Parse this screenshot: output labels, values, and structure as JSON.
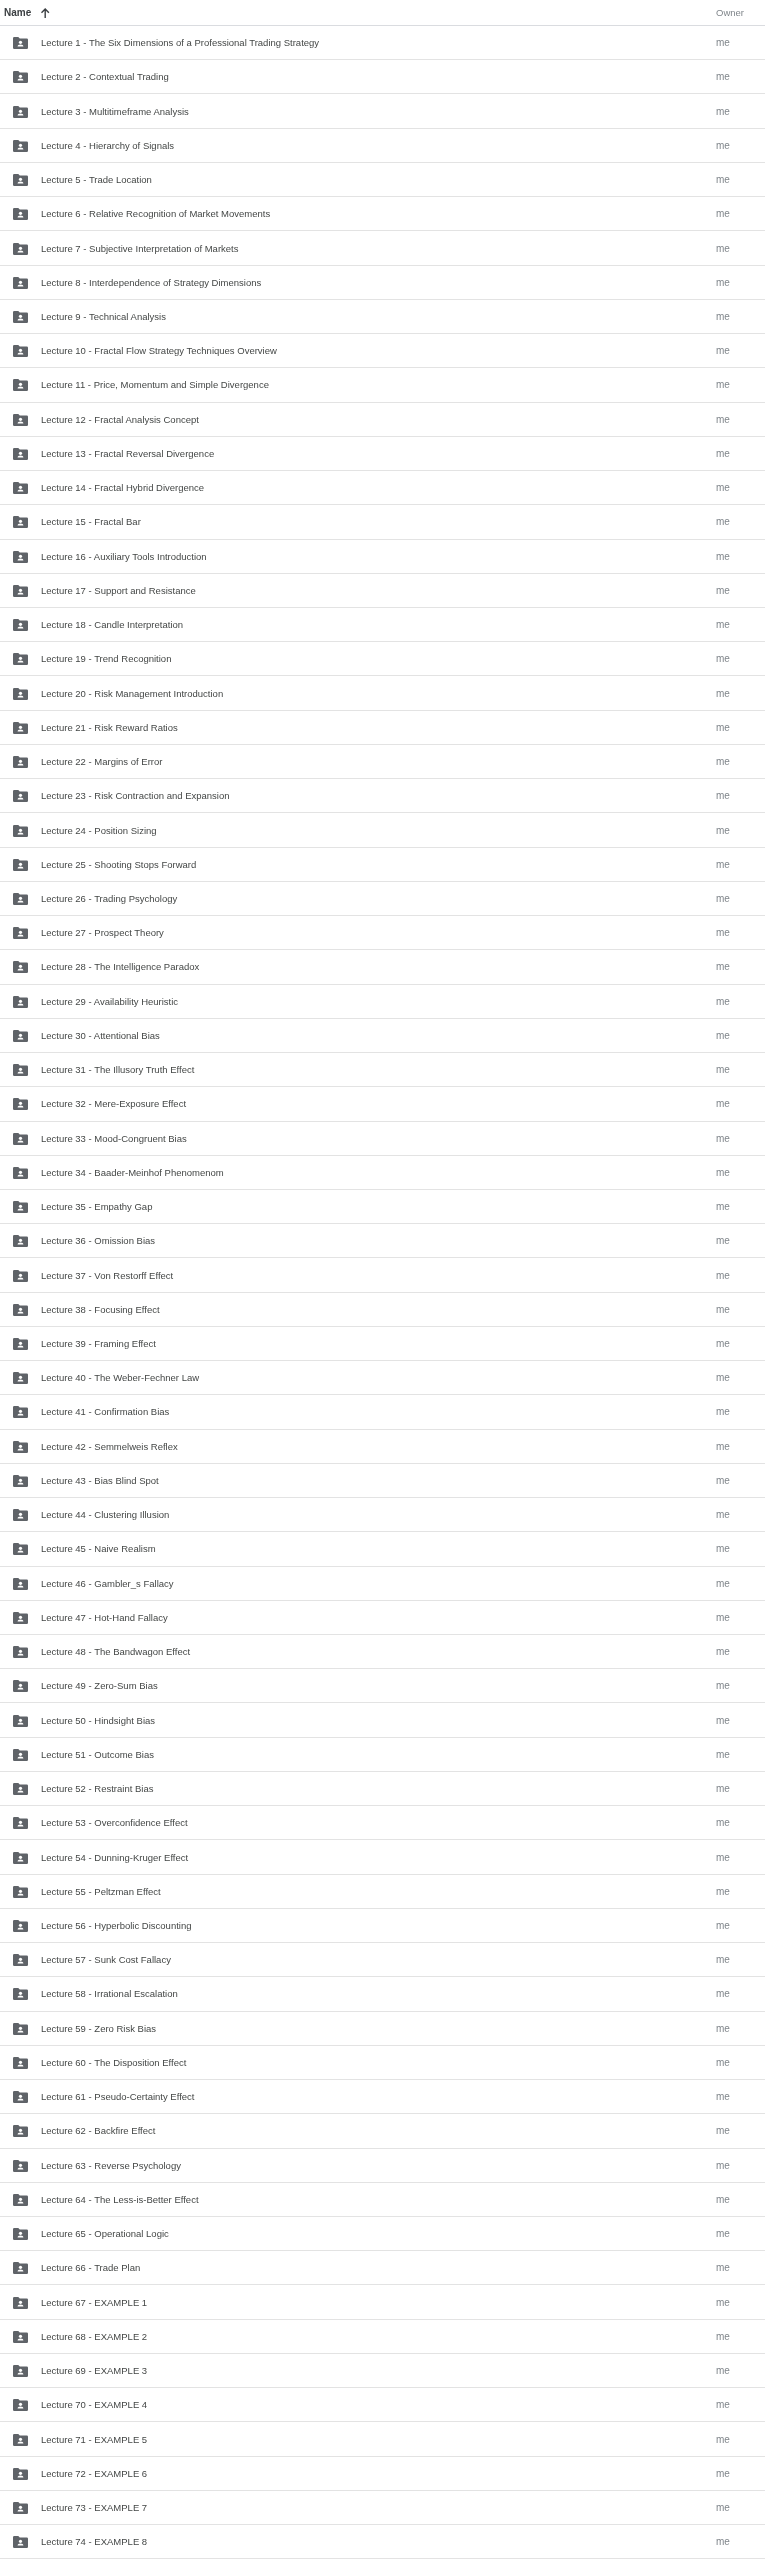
{
  "header": {
    "columns": [
      {
        "label": "Name",
        "sorted": true
      },
      {
        "label": "Owner",
        "sorted": false
      }
    ]
  },
  "rows": [
    {
      "name": "Lecture 1 - The Six Dimensions of a Professional Trading Strategy",
      "owner": "me"
    },
    {
      "name": "Lecture 2 - Contextual Trading",
      "owner": "me"
    },
    {
      "name": "Lecture 3 - Multitimeframe Analysis",
      "owner": "me"
    },
    {
      "name": "Lecture 4 - Hierarchy of Signals",
      "owner": "me"
    },
    {
      "name": "Lecture 5 - Trade Location",
      "owner": "me"
    },
    {
      "name": "Lecture 6 - Relative Recognition of Market Movements",
      "owner": "me"
    },
    {
      "name": "Lecture 7 - Subjective Interpretation of Markets",
      "owner": "me"
    },
    {
      "name": "Lecture 8 - Interdependence of Strategy Dimensions",
      "owner": "me"
    },
    {
      "name": "Lecture 9 - Technical Analysis",
      "owner": "me"
    },
    {
      "name": "Lecture 10 - Fractal Flow Strategy Techniques Overview",
      "owner": "me"
    },
    {
      "name": "Lecture 11 - Price, Momentum and Simple Divergence",
      "owner": "me"
    },
    {
      "name": "Lecture 12 - Fractal Analysis Concept",
      "owner": "me"
    },
    {
      "name": "Lecture 13 - Fractal Reversal Divergence",
      "owner": "me"
    },
    {
      "name": "Lecture 14 - Fractal Hybrid Divergence",
      "owner": "me"
    },
    {
      "name": "Lecture 15 - Fractal Bar",
      "owner": "me"
    },
    {
      "name": "Lecture 16 - Auxiliary Tools Introduction",
      "owner": "me"
    },
    {
      "name": "Lecture 17 - Support and Resistance",
      "owner": "me"
    },
    {
      "name": "Lecture 18 - Candle Interpretation",
      "owner": "me"
    },
    {
      "name": "Lecture 19 - Trend Recognition",
      "owner": "me"
    },
    {
      "name": "Lecture 20 - Risk Management Introduction",
      "owner": "me"
    },
    {
      "name": "Lecture 21 - Risk Reward Ratios",
      "owner": "me"
    },
    {
      "name": "Lecture 22 - Margins of Error",
      "owner": "me"
    },
    {
      "name": "Lecture 23 - Risk Contraction and Expansion",
      "owner": "me"
    },
    {
      "name": "Lecture 24 - Position Sizing",
      "owner": "me"
    },
    {
      "name": "Lecture 25 - Shooting Stops Forward",
      "owner": "me"
    },
    {
      "name": "Lecture 26 - Trading Psychology",
      "owner": "me"
    },
    {
      "name": "Lecture 27 - Prospect Theory",
      "owner": "me"
    },
    {
      "name": "Lecture 28 - The Intelligence Paradox",
      "owner": "me"
    },
    {
      "name": "Lecture 29 - Availability Heuristic",
      "owner": "me"
    },
    {
      "name": "Lecture 30 - Attentional Bias",
      "owner": "me"
    },
    {
      "name": "Lecture 31 - The Illusory Truth Effect",
      "owner": "me"
    },
    {
      "name": "Lecture 32 - Mere-Exposure Effect",
      "owner": "me"
    },
    {
      "name": "Lecture 33 - Mood-Congruent Bias",
      "owner": "me"
    },
    {
      "name": "Lecture 34 - Baader-Meinhof Phenomenom",
      "owner": "me"
    },
    {
      "name": "Lecture 35 - Empathy Gap",
      "owner": "me"
    },
    {
      "name": "Lecture 36 - Omission Bias",
      "owner": "me"
    },
    {
      "name": "Lecture 37 - Von Restorff Effect",
      "owner": "me"
    },
    {
      "name": "Lecture 38 - Focusing Effect",
      "owner": "me"
    },
    {
      "name": "Lecture 39 - Framing Effect",
      "owner": "me"
    },
    {
      "name": "Lecture 40 - The Weber-Fechner Law",
      "owner": "me"
    },
    {
      "name": "Lecture 41 - Confirmation Bias",
      "owner": "me"
    },
    {
      "name": "Lecture 42 - Semmelweis Reflex",
      "owner": "me"
    },
    {
      "name": "Lecture 43 - Bias Blind Spot",
      "owner": "me"
    },
    {
      "name": "Lecture 44 - Clustering Illusion",
      "owner": "me"
    },
    {
      "name": "Lecture 45 - Naive Realism",
      "owner": "me"
    },
    {
      "name": "Lecture 46 - Gambler_s Fallacy",
      "owner": "me"
    },
    {
      "name": "Lecture 47 - Hot-Hand Fallacy",
      "owner": "me"
    },
    {
      "name": "Lecture 48 - The Bandwagon Effect",
      "owner": "me"
    },
    {
      "name": "Lecture 49 - Zero-Sum Bias",
      "owner": "me"
    },
    {
      "name": "Lecture 50 - Hindsight Bias",
      "owner": "me"
    },
    {
      "name": "Lecture 51 - Outcome Bias",
      "owner": "me"
    },
    {
      "name": "Lecture 52 - Restraint Bias",
      "owner": "me"
    },
    {
      "name": "Lecture 53 - Overconfidence Effect",
      "owner": "me"
    },
    {
      "name": "Lecture 54 - Dunning-Kruger Effect",
      "owner": "me"
    },
    {
      "name": "Lecture 55 - Peltzman Effect",
      "owner": "me"
    },
    {
      "name": "Lecture 56 - Hyperbolic Discounting",
      "owner": "me"
    },
    {
      "name": "Lecture 57 - Sunk Cost Fallacy",
      "owner": "me"
    },
    {
      "name": "Lecture 58 - Irrational Escalation",
      "owner": "me"
    },
    {
      "name": "Lecture 59 - Zero Risk Bias",
      "owner": "me"
    },
    {
      "name": "Lecture 60 - The Disposition Effect",
      "owner": "me"
    },
    {
      "name": "Lecture 61 - Pseudo-Certainty Effect",
      "owner": "me"
    },
    {
      "name": "Lecture 62 - Backfire Effect",
      "owner": "me"
    },
    {
      "name": "Lecture 63 - Reverse Psychology",
      "owner": "me"
    },
    {
      "name": "Lecture 64 - The Less-is-Better Effect",
      "owner": "me"
    },
    {
      "name": "Lecture 65 - Operational Logic",
      "owner": "me"
    },
    {
      "name": "Lecture 66 - Trade Plan",
      "owner": "me"
    },
    {
      "name": "Lecture 67 - EXAMPLE 1",
      "owner": "me"
    },
    {
      "name": "Lecture 68 - EXAMPLE 2",
      "owner": "me"
    },
    {
      "name": "Lecture 69 - EXAMPLE 3",
      "owner": "me"
    },
    {
      "name": "Lecture 70 - EXAMPLE 4",
      "owner": "me"
    },
    {
      "name": "Lecture 71 - EXAMPLE 5",
      "owner": "me"
    },
    {
      "name": "Lecture 72 - EXAMPLE 6",
      "owner": "me"
    },
    {
      "name": "Lecture 73 - EXAMPLE 7",
      "owner": "me"
    },
    {
      "name": "Lecture 74 - EXAMPLE 8",
      "owner": "me"
    }
  ]
}
